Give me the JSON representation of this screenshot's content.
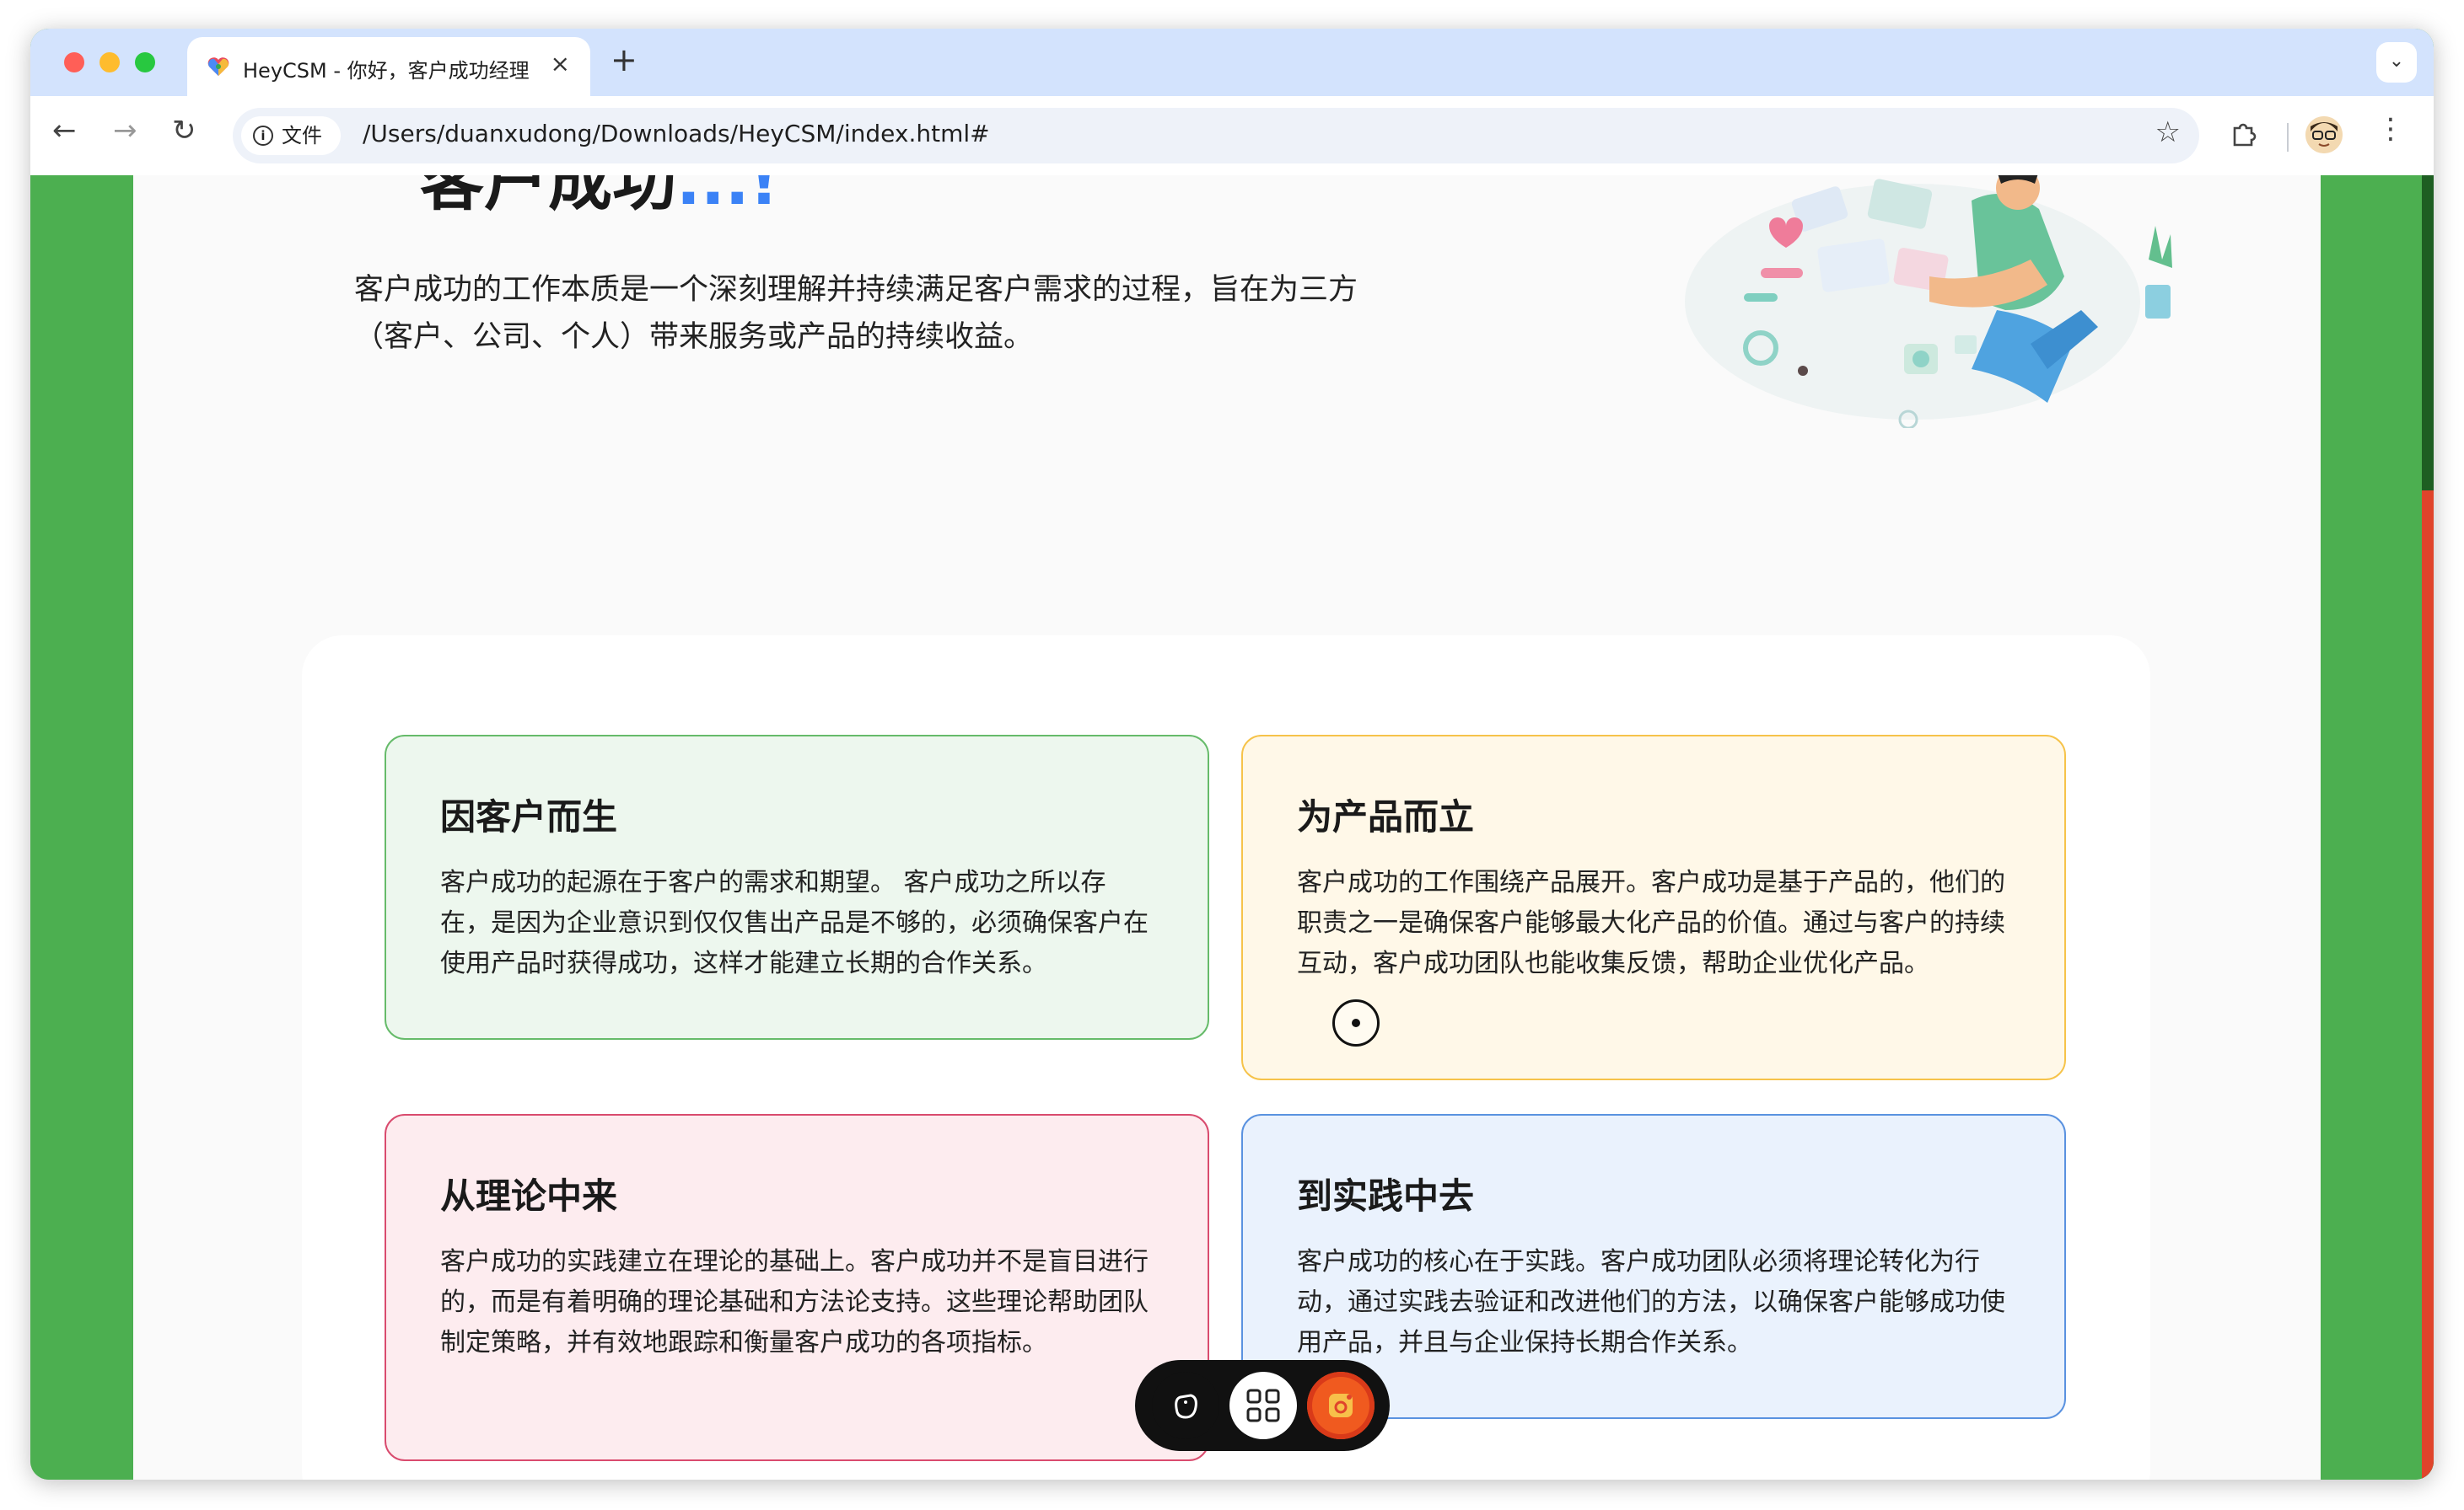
{
  "browser": {
    "tab": {
      "title": "HeyCSM - 你好，客户成功经理",
      "close": "×"
    },
    "new_tab": "+",
    "tab_search": "⌄",
    "nav": {
      "back": "←",
      "forward": "→",
      "reload": "↻"
    },
    "security_label": "文件",
    "url": "/Users/duanxudong/Downloads/HeyCSM/index.html#",
    "icons": [
      "back-arrow-icon",
      "forward-arrow-icon",
      "reload-icon",
      "info-icon",
      "star-icon",
      "extensions-icon",
      "profile-avatar",
      "more-vert-icon"
    ]
  },
  "hero": {
    "title": "客户成功",
    "title_accent": "...!",
    "description": "客户成功的工作本质是一个深刻理解并持续满足客户需求的过程，旨在为三方（客户、公司、个人）带来服务或产品的持续收益。"
  },
  "cards": [
    {
      "title": "因客户而生",
      "body": "客户成功的起源在于客户的需求和期望。 客户成功之所以存在，是因为企业意识到仅仅售出产品是不够的，必须确保客户在使用产品时获得成功，这样才能建立长期的合作关系。"
    },
    {
      "title": "为产品而立",
      "body": "客户成功的工作围绕产品展开。客户成功是基于产品的，他们的职责之一是确保客户能够最大化产品的价值。通过与客户的持续互动，客户成功团队也能收集反馈，帮助企业优化产品。"
    },
    {
      "title": "从理论中来",
      "body": "客户成功的实践建立在理论的基础上。客户成功并不是盲目进行的，而是有着明确的理论基础和方法论支持。这些理论帮助团队制定策略，并有效地跟踪和衡量客户成功的各项指标。"
    },
    {
      "title": "到实践中去",
      "body": "客户成功的核心在于实践。客户成功团队必须将理论转化为行动，通过实践去验证和改进他们的方法，以确保客户能够成功使用产品，并且与企业保持长期合作关系。"
    }
  ],
  "colors": {
    "page_bg": "#4caf50",
    "accent": "#3b82f6",
    "card_green": "#edf7ee",
    "card_yellow": "#fff8e8",
    "card_pink": "#fdecef",
    "card_blue": "#eaf2fd",
    "scroll_thumb": "#e0442b"
  },
  "dock": {
    "icons": [
      "hand-icon",
      "grid-icon",
      "screenshot-icon"
    ]
  }
}
